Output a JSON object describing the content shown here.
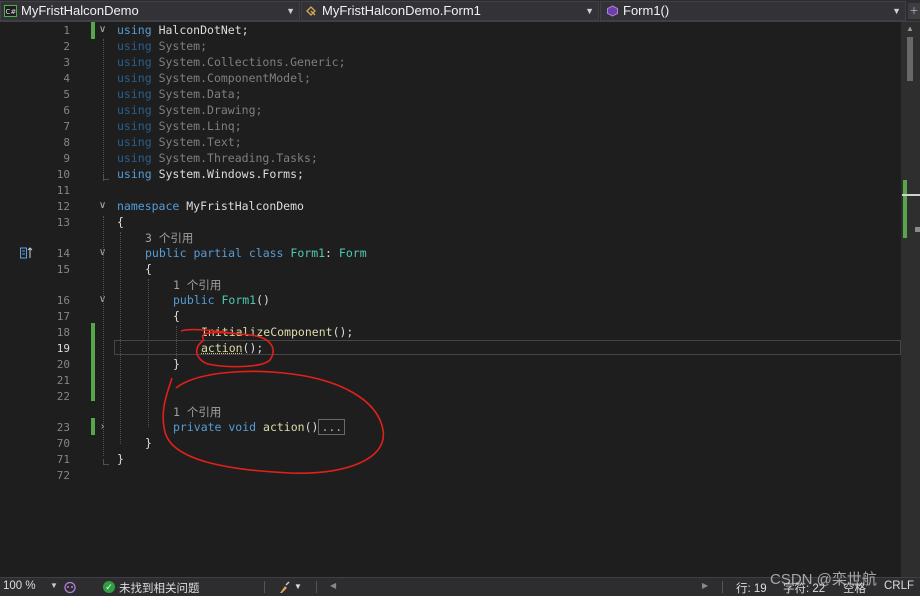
{
  "nav": {
    "project": "MyFristHalconDemo",
    "class_scope": "MyFristHalconDemo.Form1",
    "member": "Form1()"
  },
  "line_numbers": [
    "1",
    "2",
    "3",
    "4",
    "5",
    "6",
    "7",
    "8",
    "9",
    "10",
    "11",
    "12",
    "13",
    "14",
    "15",
    "16",
    "17",
    "18",
    "19",
    "20",
    "21",
    "22",
    "23",
    "70",
    "71",
    "72"
  ],
  "code": {
    "using_kw": "using",
    "using_targets": [
      "HalconDotNet;",
      "System;",
      "System.Collections.Generic;",
      "System.ComponentModel;",
      "System.Data;",
      "System.Drawing;",
      "System.Linq;",
      "System.Text;",
      "System.Threading.Tasks;",
      "System.Windows.Forms;"
    ],
    "namespace_kw": "namespace",
    "namespace_name": "MyFristHalconDemo",
    "open_brace": "{",
    "close_brace": "}",
    "class_refs": "3 个引用",
    "class_mods": "public partial class",
    "class_name": "Form1",
    "class_colon": ":",
    "class_base": "Form",
    "ctor_refs": "1 个引用",
    "ctor_kw": "public",
    "ctor_name": "Form1",
    "ctor_parens": "()",
    "init_call": "InitializeComponent",
    "call_suffix": "();",
    "action_call": "action",
    "method_refs": "1 个引用",
    "method_mods": "private void",
    "method_name": "action",
    "method_parens": "()",
    "collapsed_body": "..."
  },
  "status": {
    "zoom": "100 %",
    "issues": "未找到相关问题",
    "line": "行: 19",
    "char": "字符: 22",
    "whitespace": "空格",
    "eol": "CRLF"
  },
  "watermark": "CSDN @栾世航",
  "colors": {
    "keyword": "#569cd6",
    "type": "#4ec9b0",
    "method": "#dcdcaa",
    "change_bar": "#57a64a",
    "annotation": "#e0201b"
  }
}
